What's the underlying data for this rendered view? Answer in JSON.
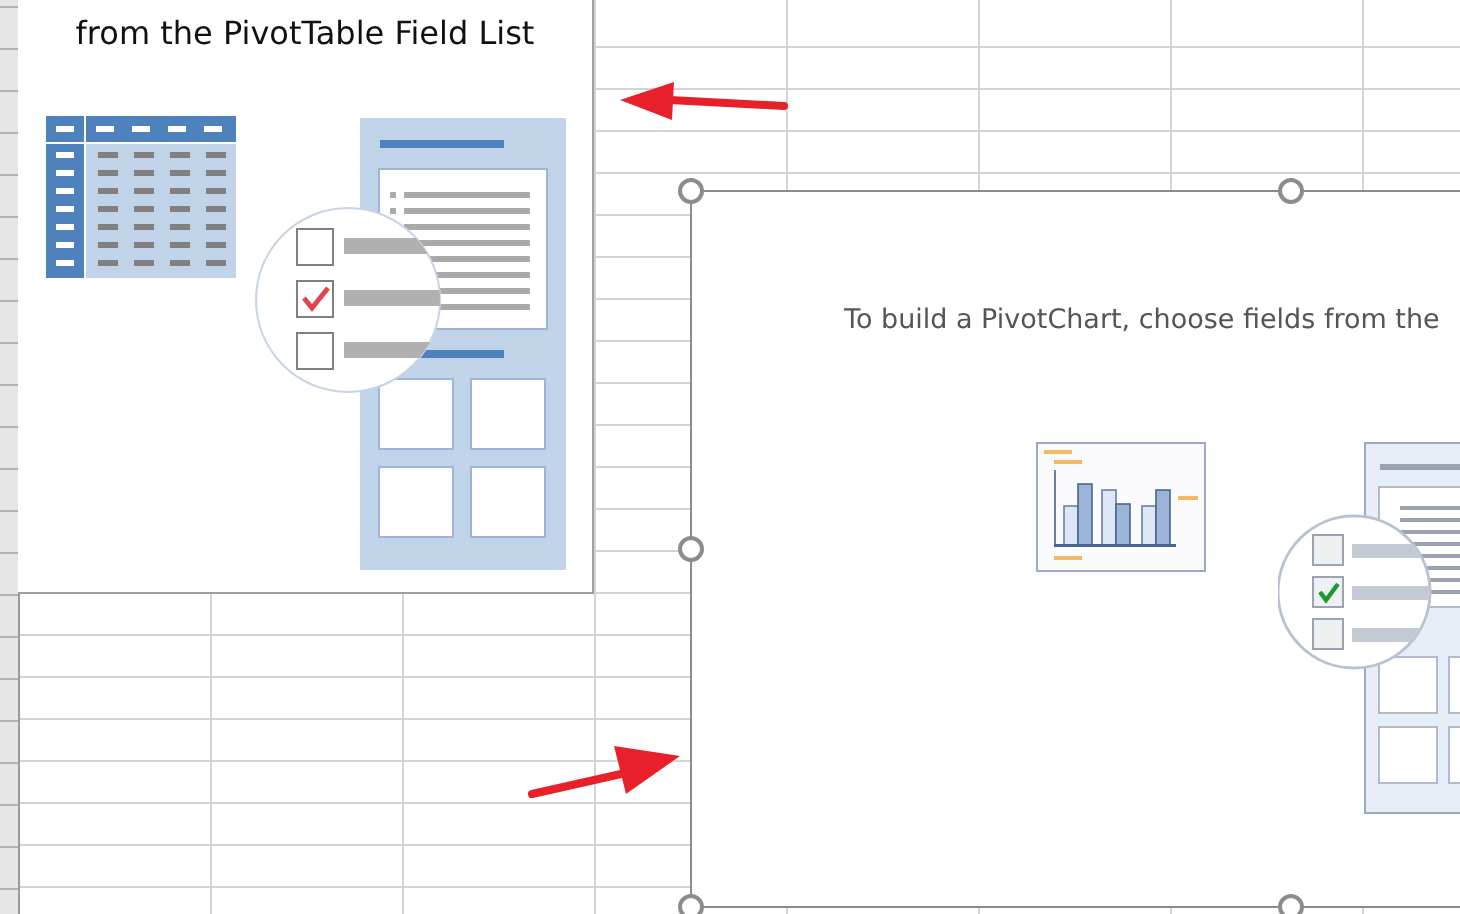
{
  "pivot_table_placeholder": {
    "text": "from the PivotTable Field List"
  },
  "pivot_chart_placeholder": {
    "text": "To build a PivotChart, choose fields from the",
    "selected": true
  }
}
